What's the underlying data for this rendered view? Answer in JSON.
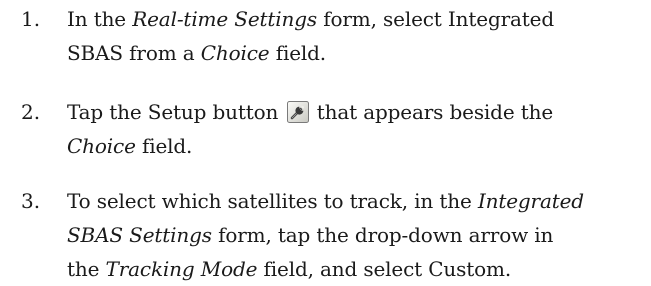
{
  "steps": [
    {
      "number": "1.",
      "line1": {
        "t1": "In the ",
        "em1": "Real-time Settings",
        "t2": " form, select Integrated"
      },
      "line2": {
        "t1": "SBAS from a ",
        "em1": "Choice",
        "t2": " field."
      }
    },
    {
      "number": "2.",
      "line1": {
        "t1": "Tap the Setup button",
        "icon": "setup-wrench-icon",
        "t2": "that appears beside the"
      },
      "line2": {
        "em1": "Choice",
        "t2": " field."
      }
    },
    {
      "number": "3.",
      "line1": {
        "t1": "To select which satellites to track, in the ",
        "em1": "Integrated"
      },
      "line2": {
        "em1": "SBAS Settings",
        "t2": " form, tap the drop-down arrow in"
      },
      "line3": {
        "t1": "the ",
        "em1": "Tracking Mode",
        "t2": " field, and select Custom."
      }
    }
  ]
}
